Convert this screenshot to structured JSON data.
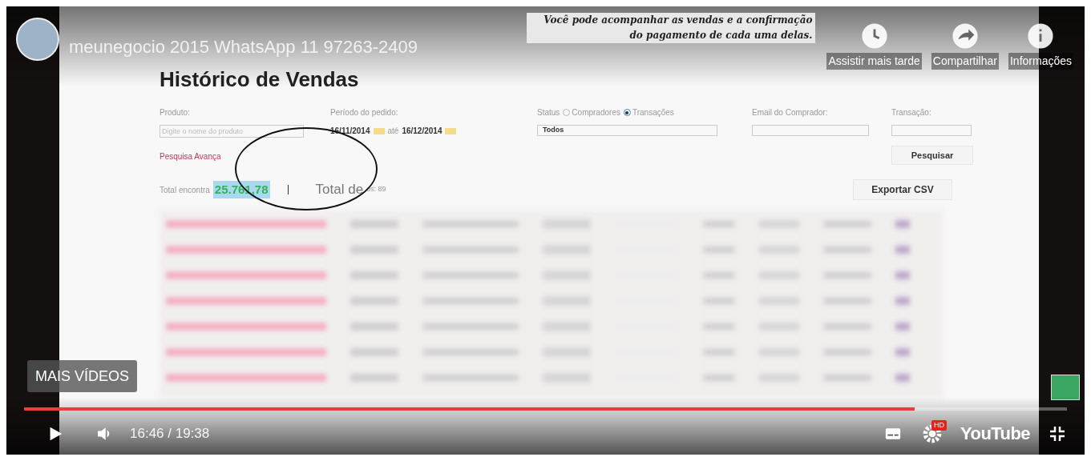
{
  "player": {
    "channel_title": "meunegocio 2015 WhatsApp 11 97263-2409",
    "actions": [
      {
        "label": "Assistir mais tarde"
      },
      {
        "label": "Compartilhar"
      },
      {
        "label": "Informações"
      }
    ],
    "more_videos": "MAIS VÍDEOS",
    "playing": false,
    "progress": {
      "level": 0.854
    },
    "time": "16:46 / 19:38",
    "hd_badge": "HD",
    "logo": "YouTube"
  },
  "page": {
    "title": "Histórico de Vendas",
    "caption": "Você pode acompanhar as vendas e a confirmação do pagamento de cada uma delas.",
    "product": {
      "label": "Produto:",
      "placeholder": "Digite o nome do produto"
    },
    "period": {
      "label": "Período do pedido:",
      "from": "16/11/2014",
      "separator": "até",
      "to": "16/12/2014"
    },
    "status": {
      "label": "Status",
      "options": [
        {
          "label": "Compradores",
          "selected": false
        },
        {
          "label": "Transações",
          "selected": true
        }
      ],
      "value": "Todos"
    },
    "email": {
      "label": "Email do Comprador:"
    },
    "transaction": {
      "label": "Transação:"
    },
    "advanced_link": "Pesquisa Avança",
    "search_button": "Pesquisar",
    "total_found_label": "Total encontra",
    "total_found_value": "25.761,78",
    "total_orders_label": "Total de",
    "total_orders_value": "os: 89",
    "export_button": "Exportar CSV"
  }
}
